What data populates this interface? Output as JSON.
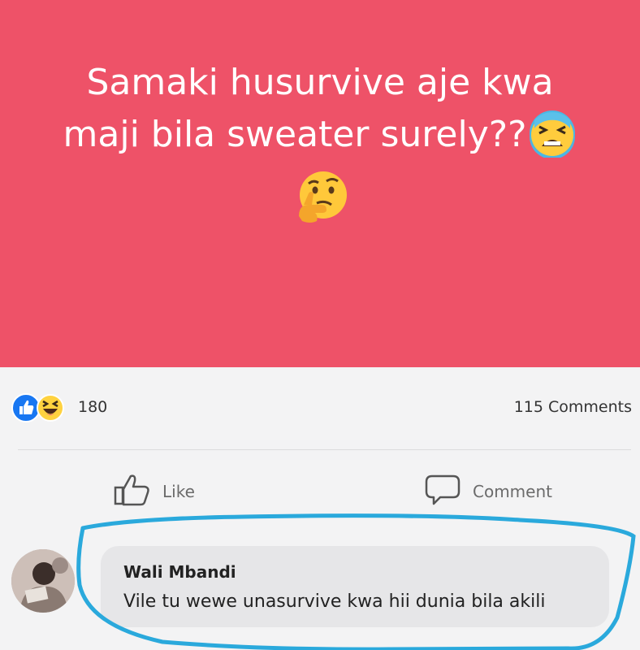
{
  "post": {
    "line1": "Samaki husurvive aje kwa",
    "line2": "maji bila sweater surely??",
    "background": "#ee5268",
    "emojis": [
      "tired-face-emoji",
      "thinking-face-emoji"
    ]
  },
  "reactions": {
    "icons": [
      "like-reaction-icon",
      "haha-reaction-icon"
    ],
    "count": "180",
    "comments_label": "115 Comments"
  },
  "actions": {
    "like_label": "Like",
    "comment_label": "Comment"
  },
  "comment": {
    "author": "Wali Mbandi",
    "text": "Vile tu wewe unasurvive kwa hii dunia bila akili"
  },
  "colors": {
    "facebook_blue": "#1877f2",
    "highlight": "#2aa9dc"
  }
}
